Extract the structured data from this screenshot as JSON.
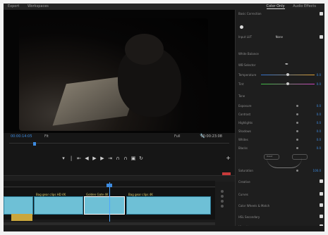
{
  "menu": {
    "left_items": [
      "Export",
      "Workspaces"
    ],
    "right_tabs": [
      "Color Only",
      "Audio Effects"
    ]
  },
  "monitor": {
    "timecode_current": "00:00:14:05",
    "fit_label": "Fit",
    "full_label": "Full",
    "timecode_duration": "00:00:23:08"
  },
  "transport_buttons": [
    "mark-in",
    "mark-out",
    "step-back",
    "play",
    "step-forward",
    "shuttle",
    "insert",
    "overwrite",
    "export-frame",
    "loop"
  ],
  "timeline": {
    "clips": [
      {
        "label": "Bag gear 4K HD"
      },
      {
        "label": "Bag gear clips HD 4K"
      },
      {
        "label": "Golden Gate 4K"
      },
      {
        "label": "Bag gear clips 4K"
      }
    ]
  },
  "lumetri": {
    "sections": [
      {
        "label": "Basic Correction"
      },
      {
        "label": "Input LUT",
        "value": "None"
      },
      {
        "label": "White Balance"
      },
      {
        "label": "WB Selector"
      },
      {
        "label": "Temperature",
        "value": "0.0"
      },
      {
        "label": "Tint",
        "value": "0.0"
      },
      {
        "label": "Tone"
      },
      {
        "label": "Exposure",
        "value": "0.0"
      },
      {
        "label": "Contrast",
        "value": "0.0"
      },
      {
        "label": "Highlights",
        "value": "0.0"
      },
      {
        "label": "Shadows",
        "value": "0.0"
      },
      {
        "label": "Whites",
        "value": "0.0"
      },
      {
        "label": "Blacks",
        "value": "0.0"
      },
      {
        "label": "Reset"
      },
      {
        "label": "Saturation",
        "value": "100.0"
      },
      {
        "label": "Creative"
      },
      {
        "label": "Curves"
      },
      {
        "label": "Color Wheels & Match"
      },
      {
        "label": "HSL Secondary"
      },
      {
        "label": "Vignette"
      }
    ]
  }
}
